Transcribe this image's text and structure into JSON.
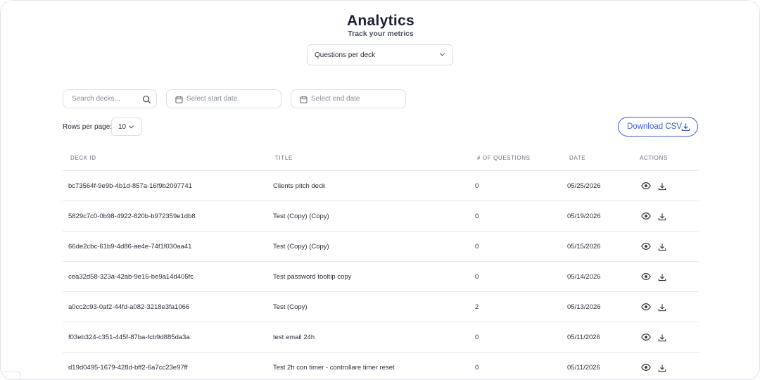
{
  "header": {
    "title": "Analytics",
    "subtitle": "Track your metrics"
  },
  "metric_select": {
    "value": "Questions per deck"
  },
  "filters": {
    "search_placeholder": "Search decks...",
    "start_date_placeholder": "Select start date",
    "end_date_placeholder": "Select end date"
  },
  "pagination": {
    "rows_label": "Rows per page:",
    "rows_value": "10"
  },
  "actions": {
    "download_csv_label": "Download CSV"
  },
  "table": {
    "columns": [
      "Deck ID",
      "Title",
      "# of questions",
      "Date",
      "Actions"
    ],
    "rows": [
      {
        "id": "bc73564f-9e9b-4b1d-857a-16f9b2097741",
        "title": "Clients pitch deck",
        "questions": "0",
        "date": "05/25/2026"
      },
      {
        "id": "5829c7c0-0b98-4922-820b-b972359e1db8",
        "title": "Test (Copy) (Copy)",
        "questions": "0",
        "date": "05/19/2026"
      },
      {
        "id": "66de2cbc-61b9-4d86-ae4e-74f1f030aa41",
        "title": "Test (Copy) (Copy)",
        "questions": "0",
        "date": "05/15/2026"
      },
      {
        "id": "cea32d58-323a-42ab-9e16-be9a14d405fc",
        "title": "Test password tooltip copy",
        "questions": "0",
        "date": "05/14/2026"
      },
      {
        "id": "a0cc2c93-0af2-44fd-a082-3218e3fa1066",
        "title": "Test (Copy)",
        "questions": "2",
        "date": "05/13/2026"
      },
      {
        "id": "f03eb324-c351-445f-87ba-fcb9d885da3a",
        "title": "test email 24h",
        "questions": "0",
        "date": "05/11/2026"
      },
      {
        "id": "d19d0495-1679-428d-bff2-6a7cc23e97ff",
        "title": "Test 2h con timer - controllare timer reset",
        "questions": "0",
        "date": "05/11/2026"
      }
    ]
  },
  "icons": {
    "search": "search-icon",
    "calendar": "calendar-icon",
    "chevron": "chevron-down-icon",
    "download": "download-icon",
    "view": "eye-icon"
  },
  "colors": {
    "accent": "#3b5bdb",
    "text": "#2b2f3a",
    "border": "#dcdee3"
  }
}
